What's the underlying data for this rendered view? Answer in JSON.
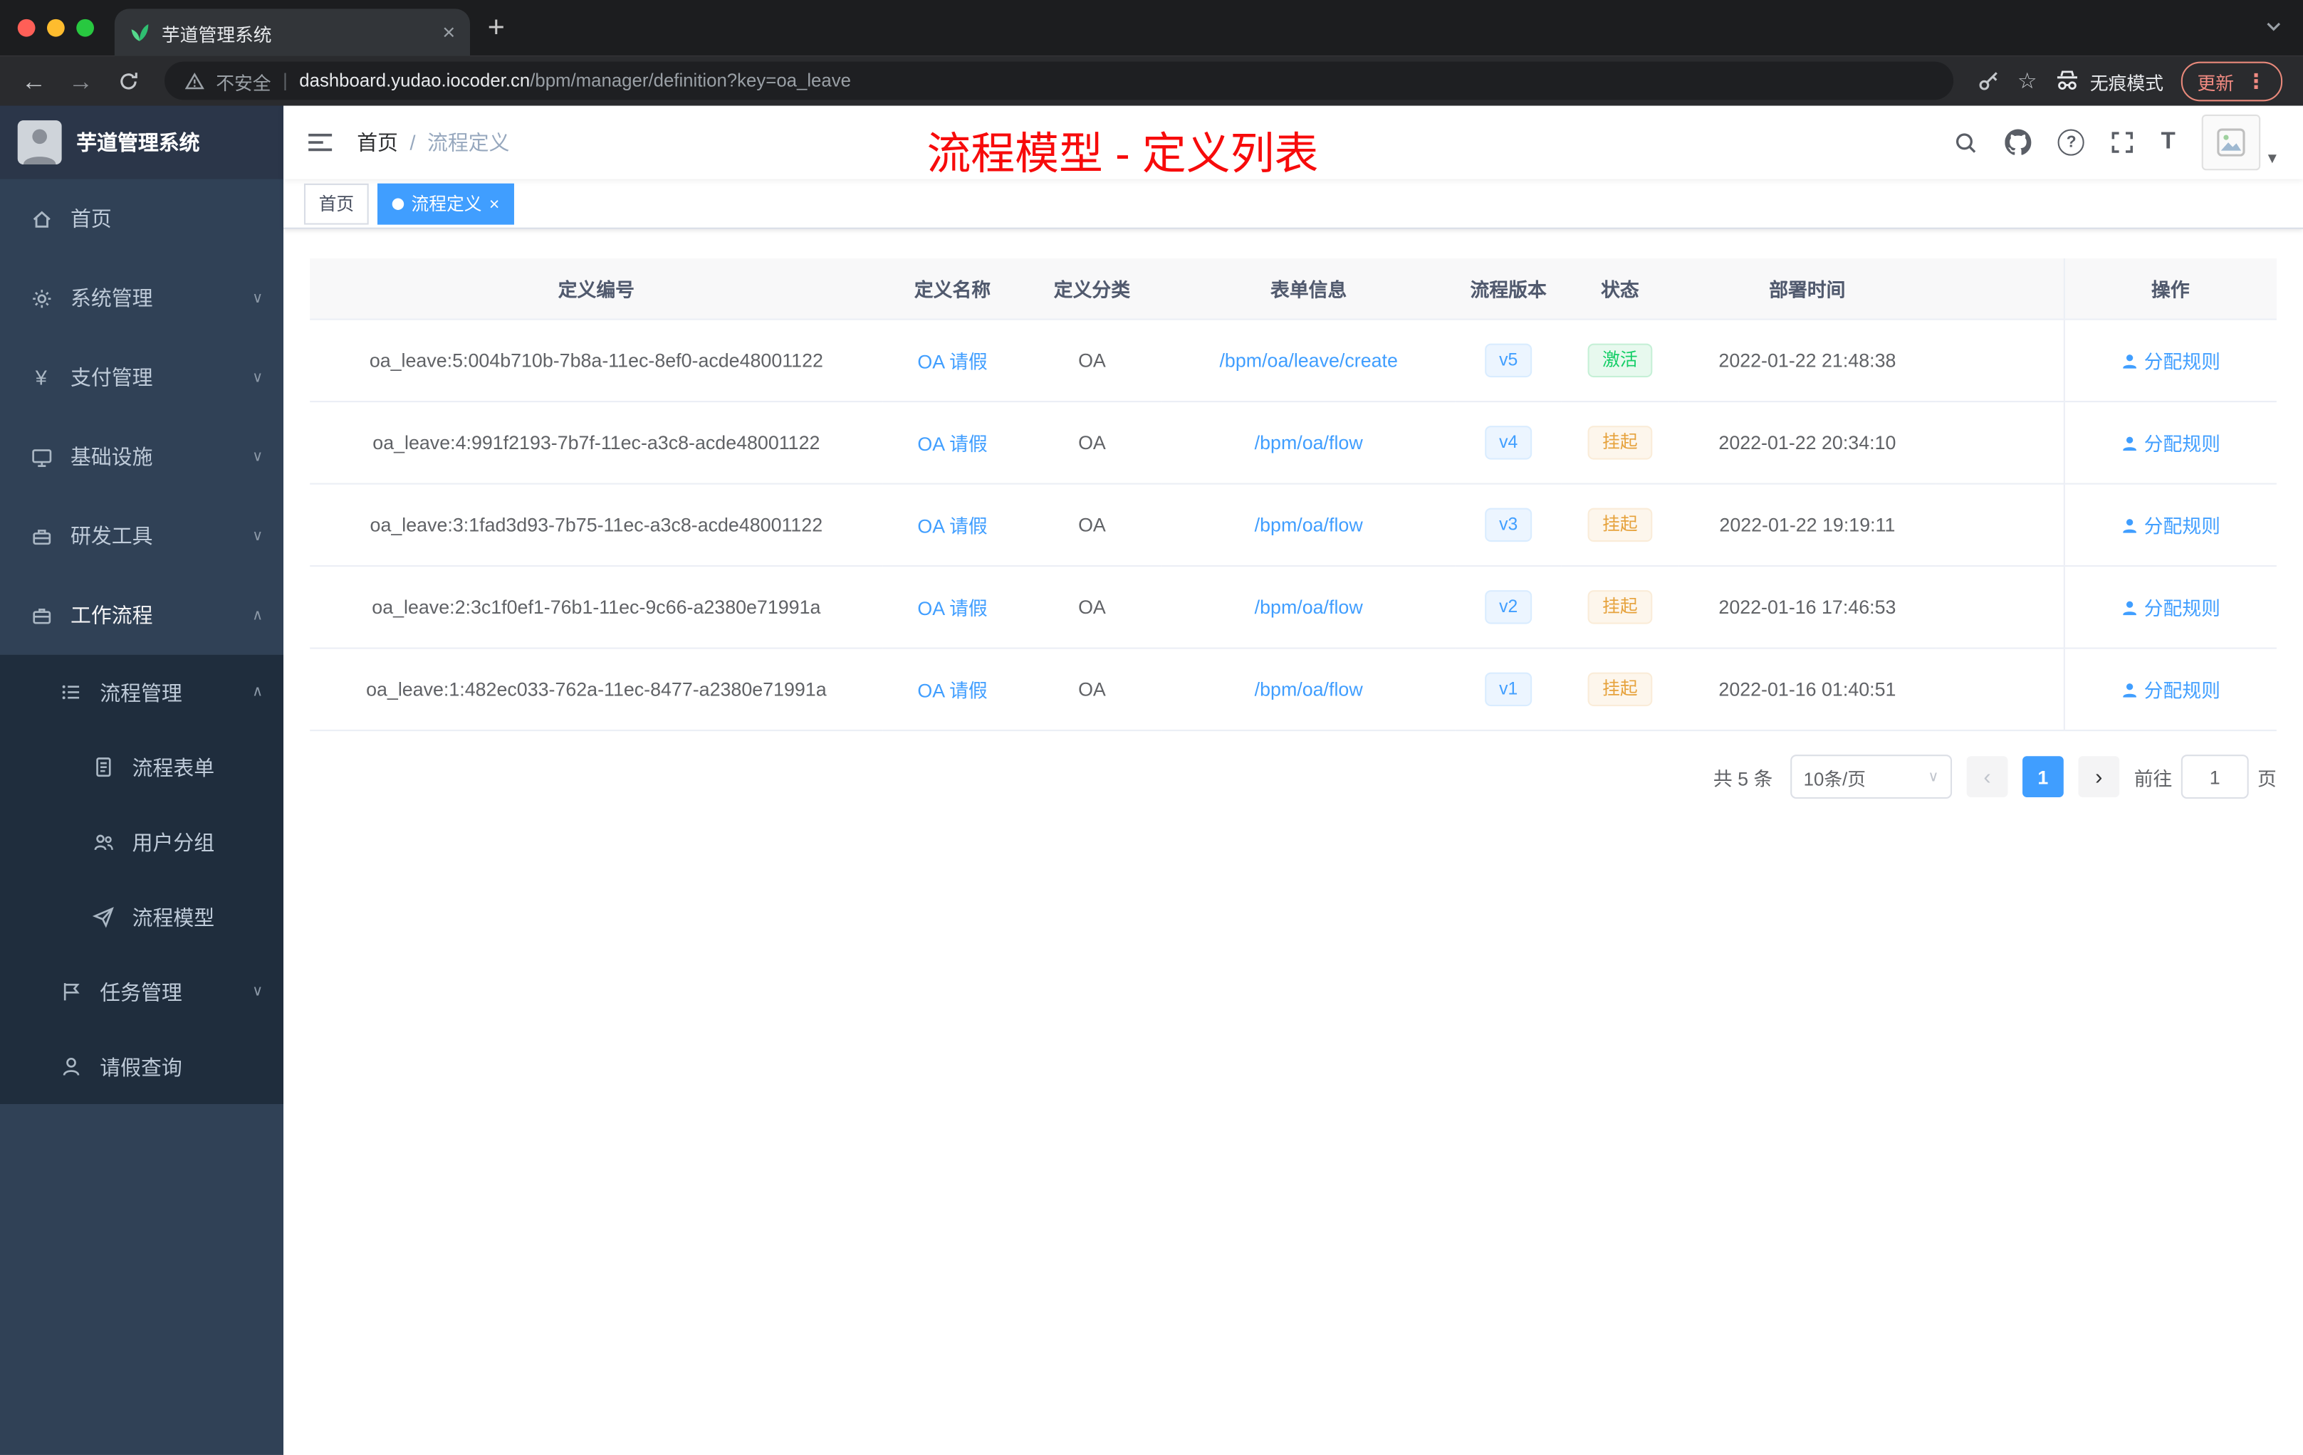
{
  "browser": {
    "tab_title": "芋道管理系统",
    "security_label": "不安全",
    "url_domain": "dashboard.yudao.iocoder.cn",
    "url_path": "/bpm/manager/definition?key=oa_leave",
    "incognito_label": "无痕模式",
    "update_label": "更新"
  },
  "sidebar": {
    "logo_title": "芋道管理系统",
    "items": [
      {
        "label": "首页",
        "icon": "home-icon"
      },
      {
        "label": "系统管理",
        "icon": "gear-icon"
      },
      {
        "label": "支付管理",
        "icon": "yen-icon"
      },
      {
        "label": "基础设施",
        "icon": "monitor-icon"
      },
      {
        "label": "研发工具",
        "icon": "toolbox-icon"
      },
      {
        "label": "工作流程",
        "icon": "briefcase-icon"
      },
      {
        "label": "流程管理",
        "icon": "list-icon"
      },
      {
        "label": "流程表单",
        "icon": "document-icon"
      },
      {
        "label": "用户分组",
        "icon": "users-icon"
      },
      {
        "label": "流程模型",
        "icon": "send-icon"
      },
      {
        "label": "任务管理",
        "icon": "flag-icon"
      },
      {
        "label": "请假查询",
        "icon": "person-icon"
      }
    ]
  },
  "navbar": {
    "breadcrumb_home": "首页",
    "breadcrumb_separator": "/",
    "breadcrumb_current": "流程定义",
    "annotation": "流程模型 - 定义列表",
    "icons": [
      "search-icon",
      "github-icon",
      "question-icon",
      "fullscreen-icon",
      "font-size-icon"
    ]
  },
  "tags": {
    "home": "首页",
    "active": "流程定义"
  },
  "table": {
    "columns": [
      "定义编号",
      "定义名称",
      "定义分类",
      "表单信息",
      "流程版本",
      "状态",
      "部署时间",
      "操作"
    ],
    "rows": [
      {
        "id": "oa_leave:5:004b710b-7b8a-11ec-8ef0-acde48001122",
        "name": "OA 请假",
        "category": "OA",
        "form": "/bpm/oa/leave/create",
        "version": "v5",
        "status": "激活",
        "time": "2022-01-22 21:48:38",
        "action": "分配规则"
      },
      {
        "id": "oa_leave:4:991f2193-7b7f-11ec-a3c8-acde48001122",
        "name": "OA 请假",
        "category": "OA",
        "form": "/bpm/oa/flow",
        "version": "v4",
        "status": "挂起",
        "time": "2022-01-22 20:34:10",
        "action": "分配规则"
      },
      {
        "id": "oa_leave:3:1fad3d93-7b75-11ec-a3c8-acde48001122",
        "name": "OA 请假",
        "category": "OA",
        "form": "/bpm/oa/flow",
        "version": "v3",
        "status": "挂起",
        "time": "2022-01-22 19:19:11",
        "action": "分配规则"
      },
      {
        "id": "oa_leave:2:3c1f0ef1-76b1-11ec-9c66-a2380e71991a",
        "name": "OA 请假",
        "category": "OA",
        "form": "/bpm/oa/flow",
        "version": "v2",
        "status": "挂起",
        "time": "2022-01-16 17:46:53",
        "action": "分配规则"
      },
      {
        "id": "oa_leave:1:482ec033-762a-11ec-8477-a2380e71991a",
        "name": "OA 请假",
        "category": "OA",
        "form": "/bpm/oa/flow",
        "version": "v1",
        "status": "挂起",
        "time": "2022-01-16 01:40:51",
        "action": "分配规则"
      }
    ]
  },
  "pagination": {
    "total": "共 5 条",
    "page_size": "10条/页",
    "page": "1",
    "goto_label": "前往",
    "goto_value": "1",
    "goto_unit": "页"
  },
  "colors": {
    "accent": "#409eff",
    "success": "#13ce66",
    "warning": "#e6a23c",
    "annotation_red": "#f70b0b",
    "sidebar_bg": "#304156",
    "sidebar_submenu_bg": "#1f2d3d"
  }
}
